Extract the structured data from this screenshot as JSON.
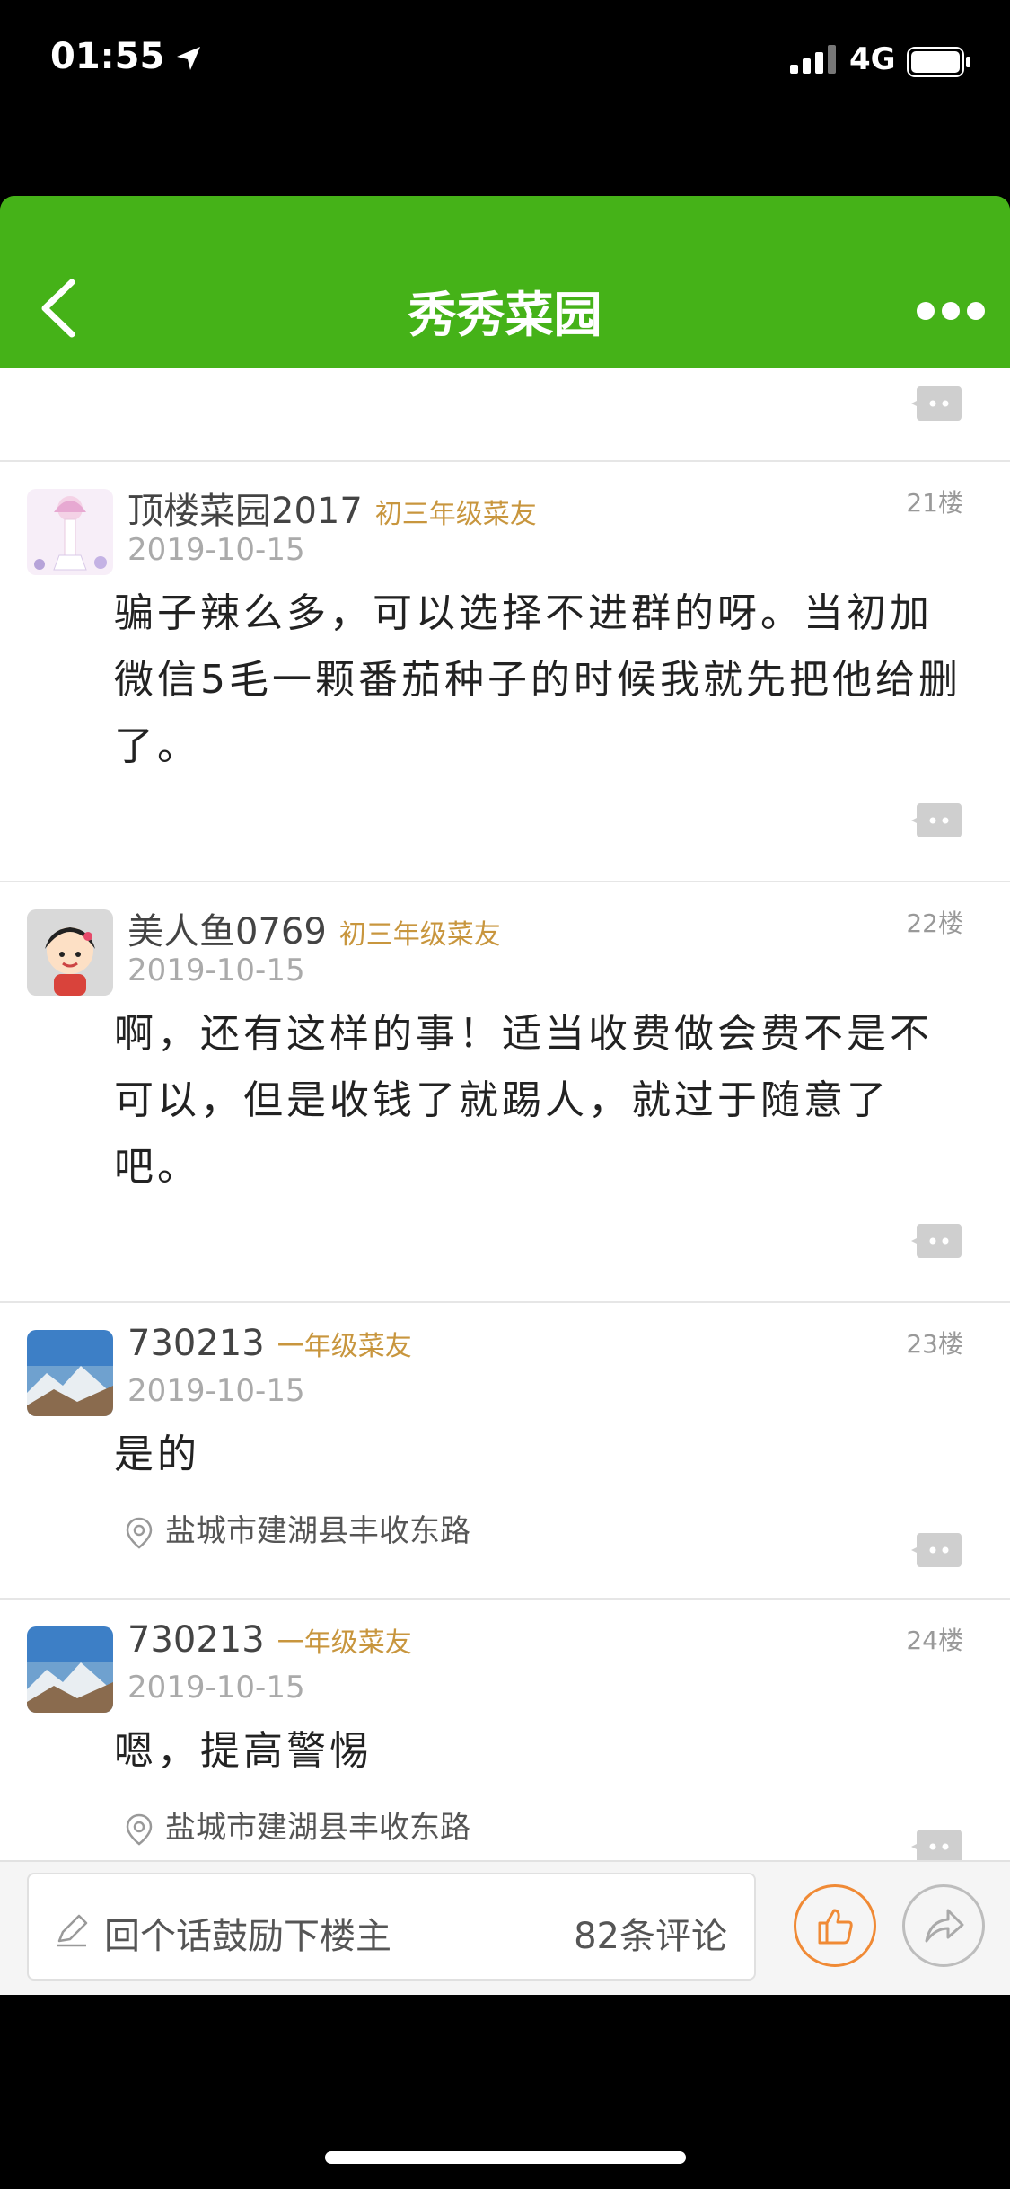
{
  "status": {
    "time": "01:55",
    "network": "4G"
  },
  "nav": {
    "title": "秀秀菜园"
  },
  "posts": [
    {
      "username": "顶楼菜园2017",
      "badge": "初三年级菜友",
      "floor": "21楼",
      "date": "2019-10-15",
      "text": "骗子辣么多，可以选择不进群的呀。当初加微信5毛一颗番茄种子的时候我就先把他给删了。"
    },
    {
      "username": "美人鱼0769",
      "badge": "初三年级菜友",
      "floor": "22楼",
      "date": "2019-10-15",
      "text": "啊，还有这样的事！适当收费做会费不是不可以，但是收钱了就踢人，就过于随意了吧。"
    },
    {
      "username": "730213",
      "badge": "一年级菜友",
      "floor": "23楼",
      "date": "2019-10-15",
      "text": "是的",
      "location": "盐城市建湖县丰收东路"
    },
    {
      "username": "730213",
      "badge": "一年级菜友",
      "floor": "24楼",
      "date": "2019-10-15",
      "text": "嗯，提高警惕",
      "location": "盐城市建湖县丰收东路"
    }
  ],
  "bottom": {
    "reply_placeholder": "回个话鼓励下楼主",
    "comment_count": "82条评论"
  },
  "colors": {
    "nav_green": "#45b218",
    "badge_gold": "#c8963e",
    "like_orange": "#f08a35"
  }
}
